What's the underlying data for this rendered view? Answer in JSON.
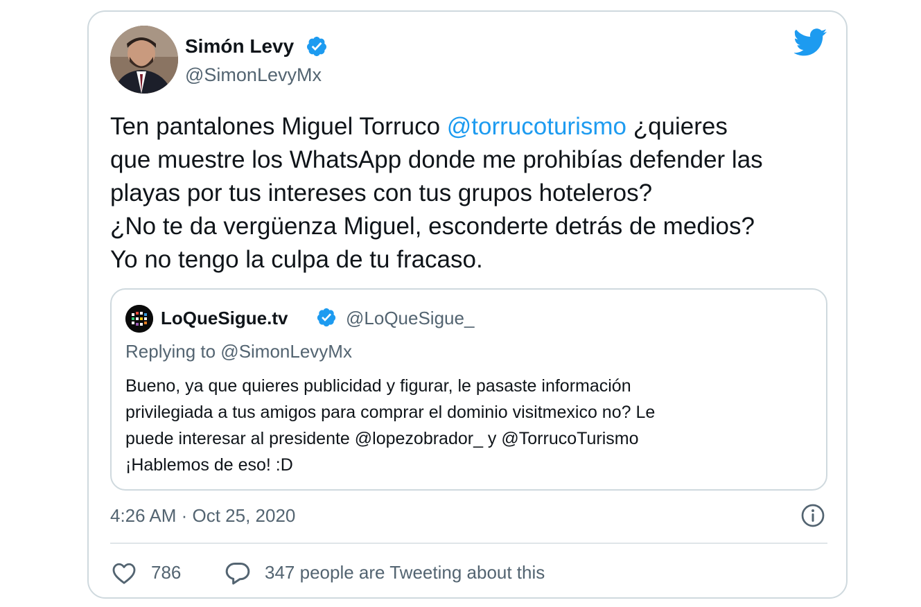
{
  "tweet": {
    "author_name": "Simón Levy",
    "author_handle": "@SimonLevyMx",
    "text_lines": [
      {
        "before": "Ten pantalones Miguel Torruco ",
        "mention": "@torrucoturismo",
        "after": " ¿quieres"
      },
      {
        "text": "que muestre los WhatsApp donde me prohibías defender las"
      },
      {
        "text": "playas por tus intereses con tus grupos hoteleros?"
      },
      {
        "text": "¿No te da vergüenza Miguel, esconderte detrás de medios?"
      },
      {
        "text": "Yo no tengo la culpa de tu fracaso."
      }
    ],
    "timestamp": "4:26 AM · Oct 25, 2020",
    "likes": "786",
    "talking": "347 people are Tweeting about this"
  },
  "quoted": {
    "author_name": "LoQueSigue.tv",
    "author_handle": "@LoQueSigue_",
    "replying_to": "Replying to @SimonLevyMx",
    "text_lines": [
      "Bueno, ya que quieres publicidad y figurar, le pasaste información",
      "privilegiada a tus amigos para comprar el dominio visitmexico no? Le",
      "puede interesar al presidente @lopezobrador_ y @TorrucoTurismo",
      "¡Hablemos de eso! :D"
    ]
  },
  "colors": {
    "accent": "#1d9bf0",
    "secondary_text": "#536471",
    "border": "#cfd9de"
  },
  "icons": {
    "verified": "verified-badge-icon",
    "brand": "twitter-bird-icon",
    "info": "info-icon",
    "like": "heart-icon",
    "reply": "speech-bubble-icon"
  }
}
